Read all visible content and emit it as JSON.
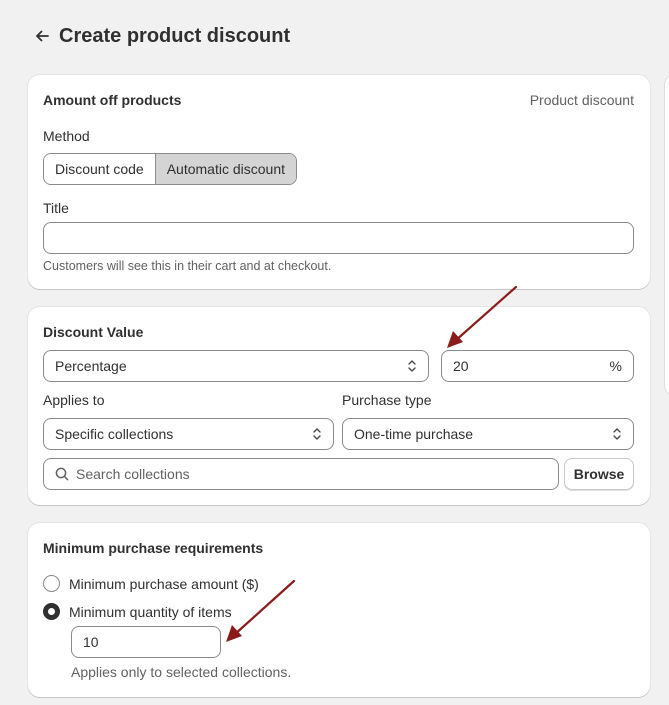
{
  "header": {
    "title": "Create product discount",
    "back_icon": "arrow-left-icon"
  },
  "amount_card": {
    "title": "Amount off products",
    "type_label": "Product discount",
    "method_label": "Method",
    "method_options": [
      "Discount code",
      "Automatic discount"
    ],
    "method_selected": "Automatic discount",
    "title_label": "Title",
    "title_value": "",
    "title_help": "Customers will see this in their cart and at checkout."
  },
  "value_card": {
    "title": "Discount Value",
    "value_type": "Percentage",
    "amount": "20",
    "suffix": "%",
    "applies_label": "Applies to",
    "applies_value": "Specific collections",
    "purchase_label": "Purchase type",
    "purchase_value": "One-time purchase",
    "search_placeholder": "Search collections",
    "browse_label": "Browse"
  },
  "min_card": {
    "title": "Minimum purchase requirements",
    "options": [
      "Minimum purchase amount ($)",
      "Minimum quantity of items"
    ],
    "selected": "Minimum quantity of items",
    "quantity": "10",
    "help": "Applies only to selected collections."
  },
  "annotations": {
    "arrow_color": "#8b1a1a"
  }
}
